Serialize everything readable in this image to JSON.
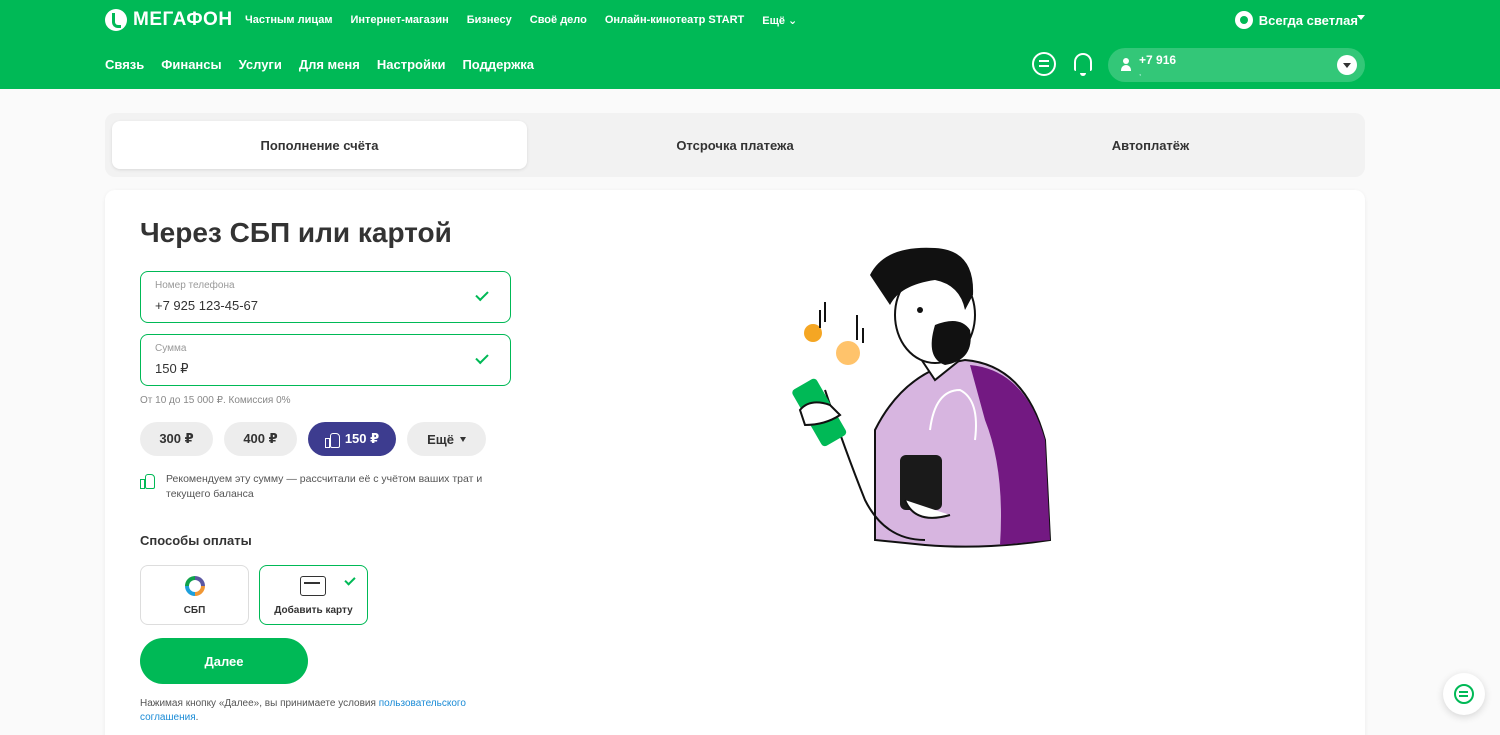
{
  "header": {
    "logo": "МЕГАФОН",
    "top_nav": [
      "Частным лицам",
      "Интернет-магазин",
      "Бизнесу",
      "Своё дело",
      "Онлайн-кинотеатр START",
      "Ещё ⌄"
    ],
    "theme_label": "Всегда светлая",
    "main_nav": [
      "Связь",
      "Финансы",
      "Услуги",
      "Для меня",
      "Настройки",
      "Поддержка"
    ],
    "account": {
      "phone": "+7 916",
      "subtitle": ","
    }
  },
  "tabs": [
    "Пополнение счёта",
    "Отсрочка платежа",
    "Автоплатёж"
  ],
  "form": {
    "title": "Через СБП или картой",
    "phone_label": "Номер телефона",
    "phone_value": "+7 925 123-45-67",
    "amount_label": "Сумма",
    "amount_value": "150 ₽",
    "hint": "От 10 до 15 000 ₽. Комиссия 0%",
    "chips": [
      "300 ₽",
      "400 ₽",
      "150 ₽",
      "Ещё"
    ],
    "recommendation": "Рекомендуем эту сумму — рассчитали её с учётом ваших трат и текущего баланса",
    "payment_title": "Способы оплаты",
    "payment_methods": [
      "СБП",
      "Добавить карту"
    ],
    "next_button": "Далее",
    "terms_prefix": "Нажимая кнопку «Далее», вы принимаете условия ",
    "terms_link": "пользовательского соглашения",
    "terms_suffix": "."
  },
  "colors": {
    "brand": "#00b956",
    "accent": "#3d3c8f",
    "illustration_purple": "#731982"
  }
}
